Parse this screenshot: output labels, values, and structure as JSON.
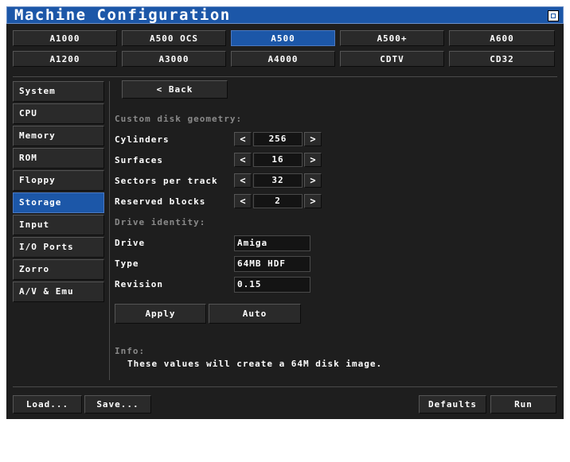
{
  "window": {
    "title": "Machine Configuration"
  },
  "models": {
    "row1": [
      "A1000",
      "A500 OCS",
      "A500",
      "A500+",
      "A600"
    ],
    "row2": [
      "A1200",
      "A3000",
      "A4000",
      "CDTV",
      "CD32"
    ],
    "selected": "A500"
  },
  "sidebar": {
    "items": [
      "System",
      "CPU",
      "Memory",
      "ROM",
      "Floppy",
      "Storage",
      "Input",
      "I/O Ports",
      "Zorro",
      "A/V & Emu"
    ],
    "selected": "Storage"
  },
  "content": {
    "back_label": "< Back",
    "geometry_heading": "Custom disk geometry:",
    "cylinders_label": "Cylinders",
    "cylinders_value": "256",
    "surfaces_label": "Surfaces",
    "surfaces_value": "16",
    "sectors_label": "Sectors per track",
    "sectors_value": "32",
    "reserved_label": "Reserved blocks",
    "reserved_value": "2",
    "step_dec": "<",
    "step_inc": ">",
    "identity_heading": "Drive identity:",
    "drive_label": "Drive",
    "drive_value": "Amiga",
    "type_label": "Type",
    "type_value": "64MB HDF",
    "revision_label": "Revision",
    "revision_value": "0.15",
    "apply_label": "Apply",
    "auto_label": "Auto",
    "info_heading": "Info:",
    "info_text": "These values will create a 64M disk image."
  },
  "footer": {
    "load_label": "Load...",
    "save_label": "Save...",
    "defaults_label": "Defaults",
    "run_label": "Run"
  },
  "colors": {
    "accent": "#1c57a8",
    "background": "#1e1e1e"
  }
}
